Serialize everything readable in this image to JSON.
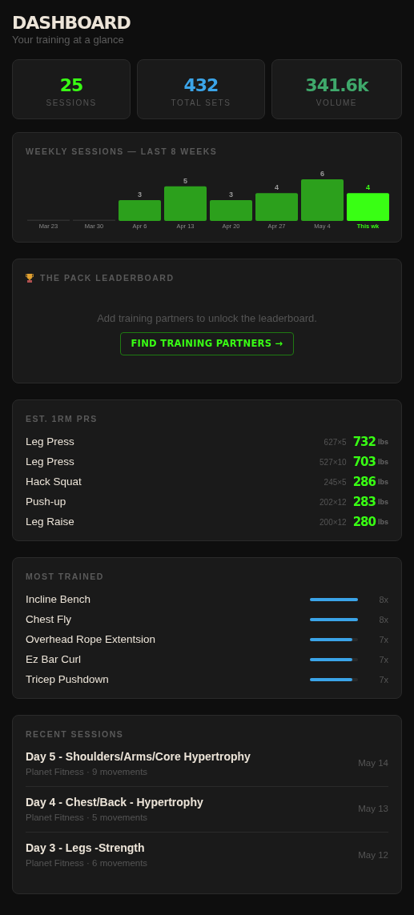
{
  "header": {
    "title": "DASHBOARD",
    "subtitle": "Your training at a glance"
  },
  "stats": [
    {
      "value": "25",
      "label": "SESSIONS",
      "color": "#39ff14"
    },
    {
      "value": "432",
      "label": "TOTAL SETS",
      "color": "#3ba4e8"
    },
    {
      "value": "341.6k",
      "label": "VOLUME",
      "color": "#3fa96b"
    }
  ],
  "weekly": {
    "chart_data": {
      "type": "bar",
      "title": "WEEKLY SESSIONS — LAST 8 WEEKS",
      "categories": [
        "Mar 23",
        "Mar 30",
        "Apr 6",
        "Apr 13",
        "Apr 20",
        "Apr 27",
        "May 4",
        "This wk"
      ],
      "series": [
        {
          "color": "#2e2e2e",
          "values": [
            0,
            0,
            null,
            null,
            null,
            null,
            null,
            null
          ]
        },
        {
          "color": "#2ca01c",
          "values": [
            null,
            null,
            3,
            5,
            3,
            4,
            6,
            null
          ],
          "value_labels": [
            null,
            null,
            "3",
            "5",
            "3",
            "4",
            "6",
            null
          ]
        },
        {
          "color": "#39ff14",
          "values": [
            null,
            null,
            null,
            null,
            null,
            null,
            null,
            4
          ],
          "value_labels": [
            null,
            null,
            null,
            null,
            null,
            null,
            null,
            "4"
          ]
        }
      ]
    }
  },
  "leaderboard": {
    "title": "THE PACK LEADERBOARD",
    "message": "Add training partners to unlock the leaderboard.",
    "button": "FIND TRAINING PARTNERS →"
  },
  "prs": {
    "title": "EST. 1RM PRS",
    "rows": [
      {
        "exercise": "Leg Press",
        "detail": "627×5",
        "value": "732",
        "unit": "lbs"
      },
      {
        "exercise": "Leg Press",
        "detail": "527×10",
        "value": "703",
        "unit": "lbs"
      },
      {
        "exercise": "Hack Squat",
        "detail": "245×5",
        "value": "286",
        "unit": "lbs"
      },
      {
        "exercise": "Push-up",
        "detail": "202×12",
        "value": "283",
        "unit": "lbs"
      },
      {
        "exercise": "Leg Raise",
        "detail": "200×12",
        "value": "280",
        "unit": "lbs"
      }
    ]
  },
  "most_trained": {
    "title": "MOST TRAINED",
    "rows": [
      {
        "exercise": "Incline Bench",
        "level": 1,
        "count": "8x"
      },
      {
        "exercise": "Chest Fly",
        "level": 1,
        "count": "8x"
      },
      {
        "exercise": "Overhead Rope Extentsion",
        "level": 0.875,
        "count": "7x"
      },
      {
        "exercise": "Ez Bar Curl",
        "level": 0.875,
        "count": "7x"
      },
      {
        "exercise": "Tricep Pushdown",
        "level": 0.875,
        "count": "7x"
      }
    ]
  },
  "recent_sessions": {
    "title": "RECENT SESSIONS",
    "rows": [
      {
        "name": "Day 5 - Shoulders/Arms/Core Hypertrophy",
        "meta": "Planet Fitness · 9 movements",
        "date": "May 14"
      },
      {
        "name": "Day 4 - Chest/Back - Hypertrophy",
        "meta": "Planet Fitness · 5 movements",
        "date": "May 13"
      },
      {
        "name": "Day 3 - Legs -Strength",
        "meta": "Planet Fitness · 6 movements",
        "date": "May 12"
      }
    ]
  }
}
